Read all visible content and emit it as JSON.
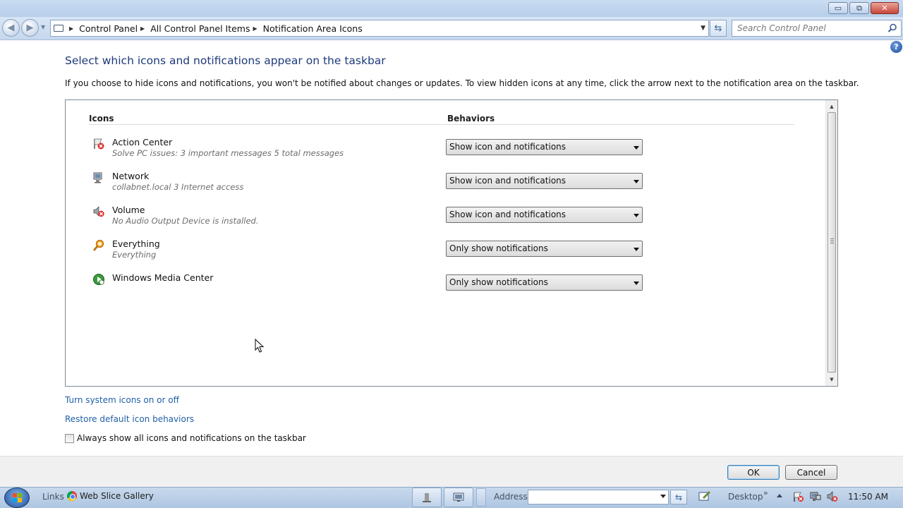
{
  "window": {
    "controls": {
      "minimize": "▭",
      "maximize": "⧉",
      "close": "✕"
    }
  },
  "navigation": {
    "back_icon": "back-arrow-icon",
    "forward_icon": "forward-arrow-icon",
    "breadcrumbs": [
      "Control Panel",
      "All Control Panel Items",
      "Notification Area Icons"
    ],
    "search_placeholder": "Search Control Panel"
  },
  "page": {
    "title": "Select which icons and notifications appear on the taskbar",
    "description": "If you choose to hide icons and notifications, you won't be notified about changes or updates. To view hidden icons at any time, click the arrow next to the notification area on the taskbar."
  },
  "table": {
    "col_icons": "Icons",
    "col_behaviors": "Behaviors",
    "rows": [
      {
        "name": "Action Center",
        "desc": "Solve PC issues: 3 important messages  5 total messages",
        "behavior": "Show icon and notifications",
        "icon": "action-center-flag-icon"
      },
      {
        "name": "Network",
        "desc": "collabnet.local  3 Internet access",
        "behavior": "Show icon and notifications",
        "icon": "network-icon"
      },
      {
        "name": "Volume",
        "desc": "No Audio Output Device is installed.",
        "behavior": "Show icon and notifications",
        "icon": "volume-muted-icon"
      },
      {
        "name": "Everything",
        "desc": "Everything",
        "behavior": "Only show notifications",
        "icon": "everything-search-icon"
      },
      {
        "name": "Windows Media Center",
        "desc": "",
        "behavior": "Only show notifications",
        "icon": "media-center-icon"
      }
    ]
  },
  "links": {
    "system_icons": "Turn system icons on or off",
    "restore_defaults": "Restore default icon behaviors"
  },
  "checkbox": {
    "label": "Always show all icons and notifications on the taskbar",
    "checked": false
  },
  "buttons": {
    "ok": "OK",
    "cancel": "Cancel"
  },
  "taskbar": {
    "links_label": "Links",
    "web_slice": "Web Slice Gallery",
    "address_label": "Address",
    "address_value": "",
    "desktop_label": "Desktop",
    "chevron": "»",
    "clock": "11:50 AM"
  },
  "colors": {
    "title_blue": "#1e3a7b",
    "link_blue": "#1f5fa8",
    "taskbar": "#aec6e2"
  }
}
